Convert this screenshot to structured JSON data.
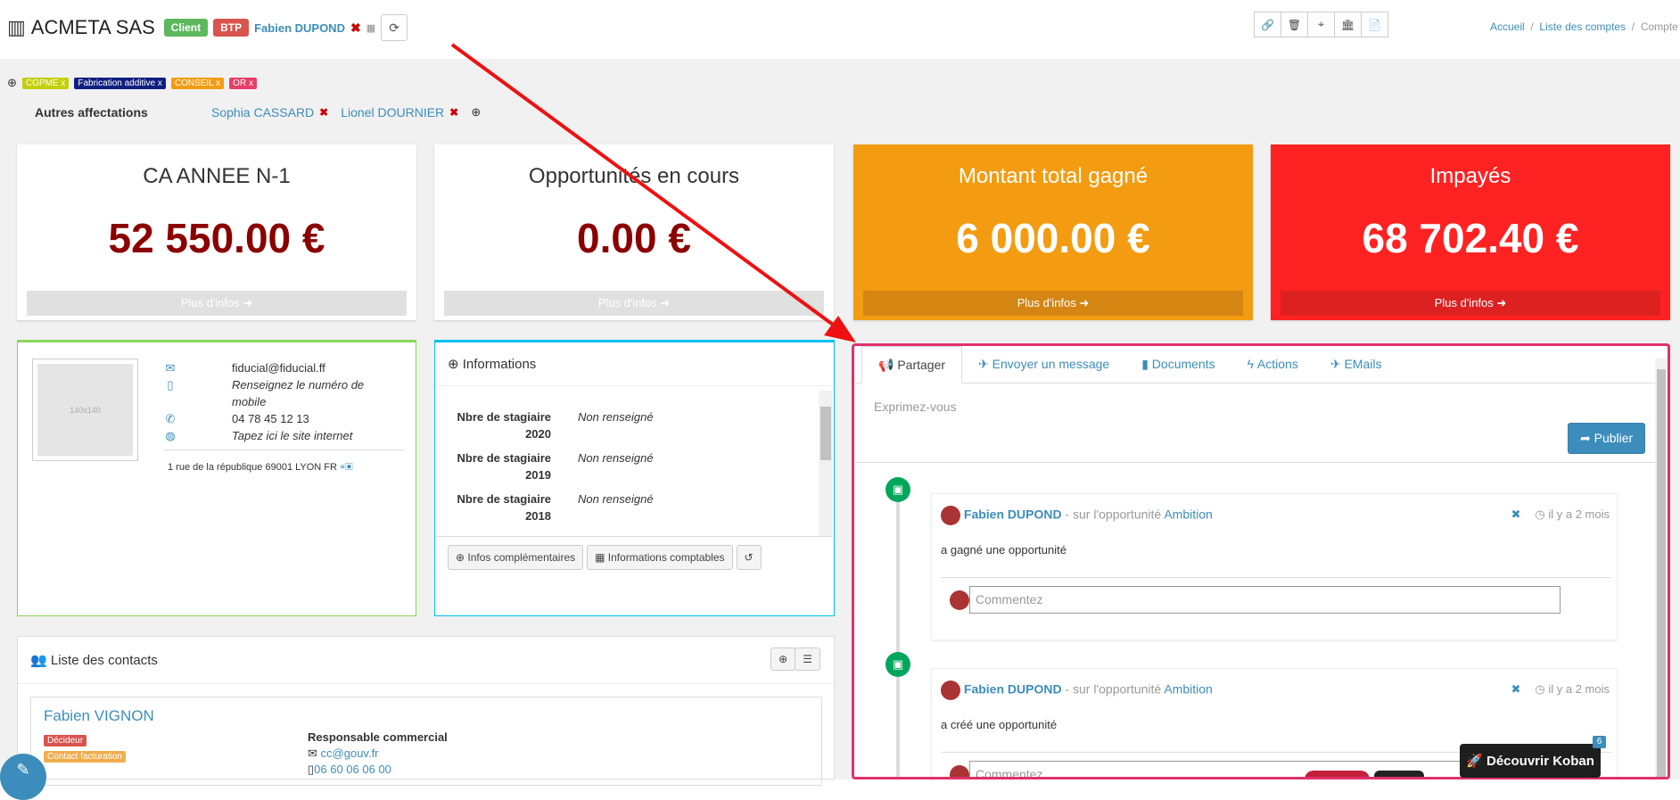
{
  "header": {
    "company": "ACMETA SAS",
    "label_client": "Client",
    "label_btp": "BTP",
    "owner": "Fabien DUPOND"
  },
  "breadcrumb": {
    "home": "Accueil",
    "list": "Liste des comptes",
    "current": "Compte"
  },
  "tags": [
    {
      "label": "CGPME x",
      "color": "#c3cf0a"
    },
    {
      "label": "Fabrication additive x",
      "color": "#0f1f80"
    },
    {
      "label": "CONSEIL x",
      "color": "#f39c12"
    },
    {
      "label": "OR x",
      "color": "#e83e6a"
    }
  ],
  "affect": {
    "label": "Autres affectations",
    "person1": "Sophia CASSARD",
    "person2": "Lionel DOURNIER"
  },
  "kpis": [
    {
      "title": "CA ANNEE N-1",
      "value": "52 550.00 €",
      "more": "Plus d'infos",
      "bg": "#ffffff",
      "text": "#333",
      "value_color": "#8b0000",
      "more_bg": "#e0e0e0",
      "more_color": "#fff"
    },
    {
      "title": "Opportunités en cours",
      "value": "0.00 €",
      "more": "Plus d'infos",
      "bg": "#ffffff",
      "text": "#333",
      "value_color": "#8b0000",
      "more_bg": "#e0e0e0",
      "more_color": "#fff"
    },
    {
      "title": "Montant total gagné",
      "value": "6 000.00 €",
      "more": "Plus d'infos",
      "bg": "#f39c12",
      "text": "#fff",
      "value_color": "#fff",
      "more_bg": "#d58512",
      "more_color": "#fff"
    },
    {
      "title": "Impayés",
      "value": "68 702.40 €",
      "more": "Plus d'infos",
      "bg": "#ff2222",
      "text": "#fff",
      "value_color": "#fff",
      "more_bg": "#dd2020",
      "more_color": "#fff"
    }
  ],
  "contact_card": {
    "avatar": "140x140",
    "email": "fiducial@fiducial.ff",
    "mobile": "Renseignez le numéro de mobile",
    "phone": "04 78 45 12 13",
    "website": "Tapez ici le site internet",
    "address": "1 rue de la république 69001 LYON FR"
  },
  "info": {
    "title": "Informations",
    "rows": [
      {
        "label1": "Nbre de stagiaire",
        "label2": "2020",
        "value": "Non renseigné"
      },
      {
        "label1": "Nbre de stagiaire",
        "label2": "2019",
        "value": "Non renseigné"
      },
      {
        "label1": "Nbre de stagiaire",
        "label2": "2018",
        "value": "Non renseigné"
      }
    ],
    "btn_more": "Infos complémentaires",
    "btn_accounting": "Informations comptables"
  },
  "contacts": {
    "title": "Liste des contacts",
    "name": "Fabien VIGNON",
    "badge1": "Décideur",
    "badge2": "Contact facturation",
    "role": "Responsable commercial",
    "email": "cc@gouv.fr",
    "phone": "06 60 06 06 00"
  },
  "feed": {
    "tabs": [
      "Partager",
      "Envoyer un message",
      "Documents",
      "Actions",
      "EMails"
    ],
    "placeholder": "Exprimez-vous",
    "publish": "Publier",
    "posts": [
      {
        "author": "Fabien DUPOND",
        "mid": "- sur l'opportunité",
        "opp": "Ambition",
        "time": "il y a 2 mois",
        "body": "a gagné une opportunité",
        "comment": "Commentez"
      },
      {
        "author": "Fabien DUPOND",
        "mid": "- sur l'opportunité",
        "opp": "Ambition",
        "time": "il y a 2 mois",
        "body": "a créé une opportunité",
        "comment": "Commentez"
      }
    ]
  },
  "discover": {
    "label": "Découvrir Koban",
    "count": "6"
  }
}
